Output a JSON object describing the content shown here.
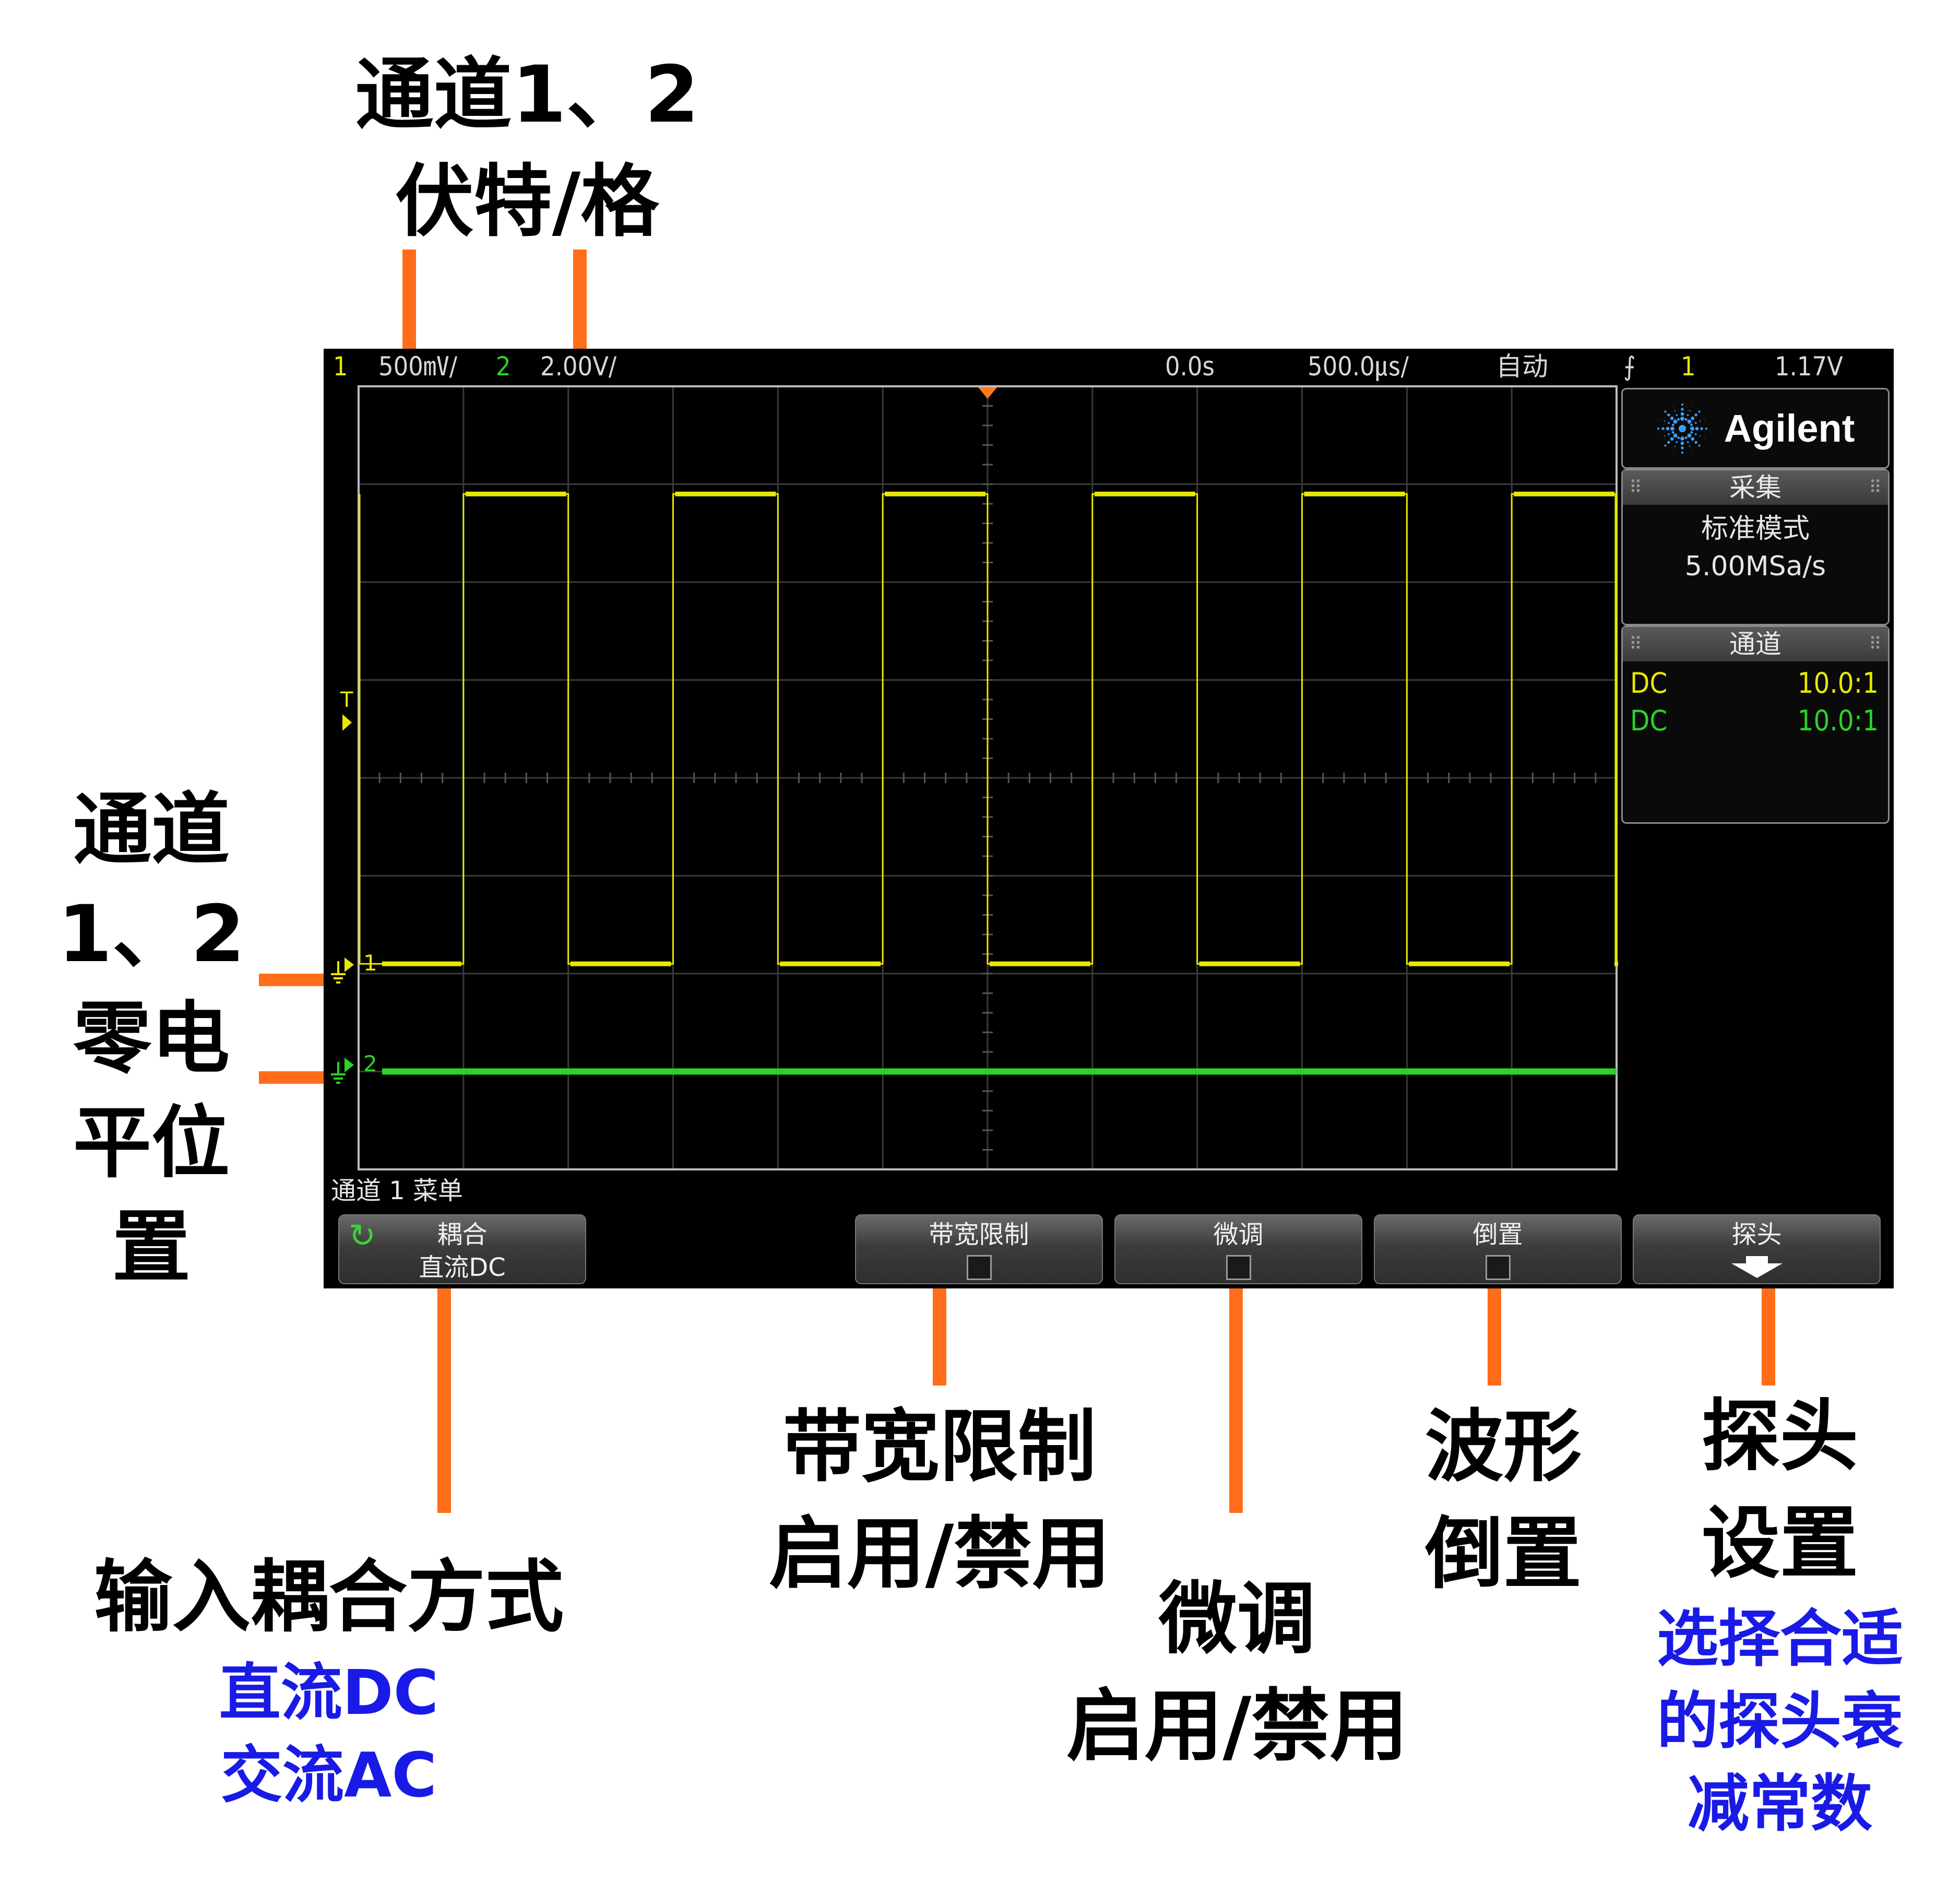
{
  "annotations": {
    "top_line1": "通道1、2",
    "top_line2": "伏特/格",
    "left_line1": "通道",
    "left_line2": "1、2",
    "left_line3": "零电",
    "left_line4": "平位",
    "left_line5": "置",
    "coupling_title": "输入耦合方式",
    "coupling_dc": "直流DC",
    "coupling_ac": "交流AC",
    "bwlimit_line1": "带宽限制",
    "bwlimit_line2": "启用/禁用",
    "vernier_line1": "微调",
    "vernier_line2": "启用/禁用",
    "invert_line1": "波形",
    "invert_line2": "倒置",
    "probe_line1": "探头",
    "probe_line2": "设置",
    "probe_desc1": "选择合适",
    "probe_desc2": "的探头衰",
    "probe_desc3": "减常数"
  },
  "status_bar": {
    "ch1_num": "1",
    "ch1_scale": "500㎷/",
    "ch2_num": "2",
    "ch2_scale": "2.00V/",
    "time_delay": "0.0s",
    "time_scale": "500.0㎲/",
    "trigger_mode": "自动",
    "trigger_slope_icon": "rising-edge-icon",
    "trigger_source": "1",
    "trigger_level": "1.17V"
  },
  "markers": {
    "trigger_level_label": "T",
    "ch1_label": "1",
    "ch2_label": "2"
  },
  "side_panel": {
    "brand": "Agilent",
    "acquisition_header": "采集",
    "acquisition_mode": "标准模式",
    "sample_rate": "5.00MSa/s",
    "channels_header": "通道",
    "channels": [
      {
        "coupling": "DC",
        "probe": "10.0:1",
        "color": "#e8e800"
      },
      {
        "coupling": "DC",
        "probe": "10.0:1",
        "color": "#2ad42a"
      }
    ]
  },
  "menu": {
    "title": "通道 1 菜单",
    "softkeys": {
      "coupling_label": "耦合",
      "coupling_value": "直流DC",
      "bwlimit_label": "带宽限制",
      "vernier_label": "微调",
      "invert_label": "倒置",
      "probe_label": "探头"
    }
  },
  "colors": {
    "ch1": "#e8e800",
    "ch2": "#2ad42a",
    "annotation_lead": "#ff6d1a",
    "annotation_blue": "#1a1ae6"
  },
  "waveforms": {
    "ch1": {
      "type": "square",
      "high_divisions": 2.9,
      "low_divisions": -1.9,
      "period_divisions": 2,
      "starts_low_at_division": 0,
      "first_rise_division": 1
    },
    "ch2": {
      "type": "dc",
      "level_divisions": -3.0
    }
  }
}
